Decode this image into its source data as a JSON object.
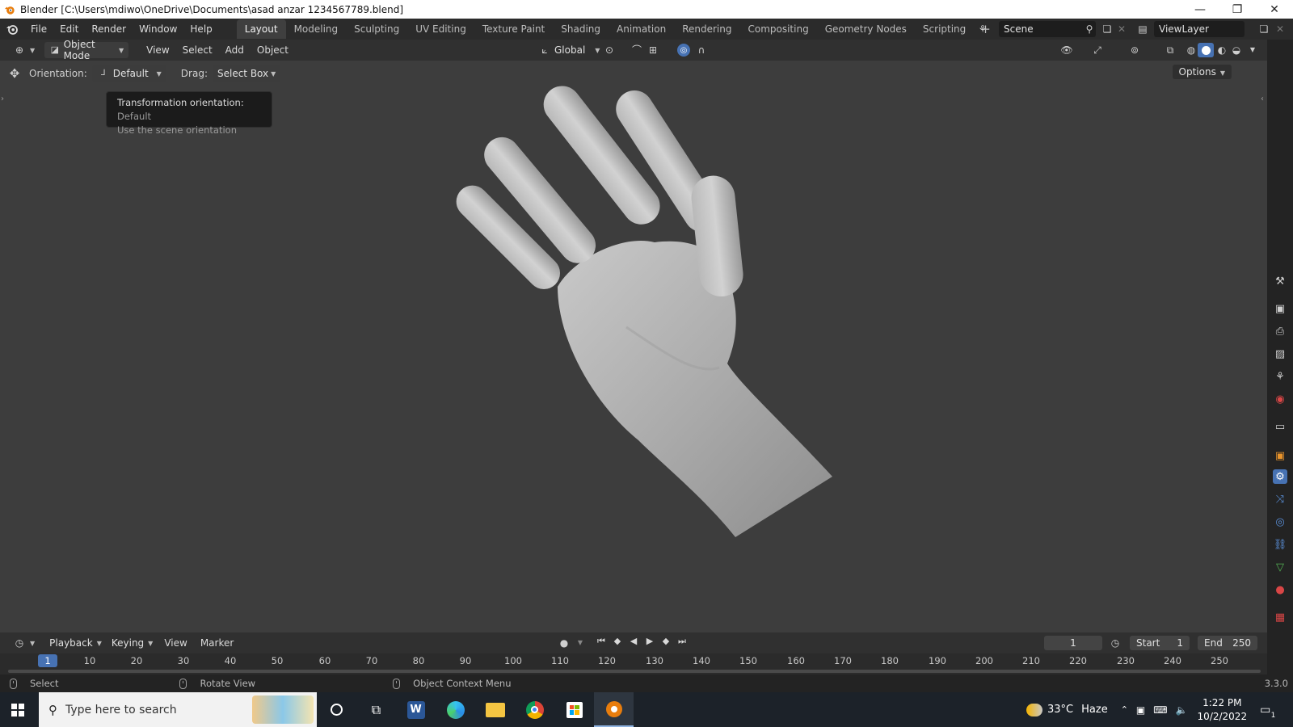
{
  "window": {
    "title": "Blender [C:\\Users\\mdiwo\\OneDrive\\Documents\\asad anzar 1234567789.blend]",
    "minimize": "—",
    "restore": "❐",
    "close": "✕"
  },
  "menus": [
    "File",
    "Edit",
    "Render",
    "Window",
    "Help"
  ],
  "workspaces": {
    "tabs": [
      "Layout",
      "Modeling",
      "Sculpting",
      "UV Editing",
      "Texture Paint",
      "Shading",
      "Animation",
      "Rendering",
      "Compositing",
      "Geometry Nodes",
      "Scripting"
    ],
    "active": "Layout",
    "add": "+"
  },
  "scene": {
    "name": "Scene",
    "view_layer": "ViewLayer"
  },
  "viewport_header": {
    "mode": "Object Mode",
    "menus": [
      "View",
      "Select",
      "Add",
      "Object"
    ],
    "transform_space": "Global"
  },
  "tool_settings": {
    "orientation_label": "Orientation:",
    "orientation_value": "Default",
    "drag_label": "Drag:",
    "drag_value": "Select Box",
    "options": "Options"
  },
  "tooltip": {
    "line1_label": "Transformation orientation:",
    "line1_value": "Default",
    "line2": "Use the scene orientation"
  },
  "timeline": {
    "menus": [
      "Playback",
      "Keying",
      "View",
      "Marker"
    ],
    "current_frame": "1",
    "start_label": "Start",
    "start_value": "1",
    "end_label": "End",
    "end_value": "250",
    "ticks": [
      "10",
      "20",
      "30",
      "40",
      "50",
      "60",
      "70",
      "80",
      "90",
      "100",
      "110",
      "120",
      "130",
      "140",
      "150",
      "160",
      "170",
      "180",
      "190",
      "200",
      "210",
      "220",
      "230",
      "240",
      "250"
    ],
    "cursor_label": "1"
  },
  "statusbar": {
    "left_action": "Select",
    "middle_action": "Rotate View",
    "right_action": "Object Context Menu",
    "version": "3.3.0"
  },
  "taskbar": {
    "search_placeholder": "Type here to search",
    "weather_temp": "33°C",
    "weather_desc": "Haze",
    "time": "1:22 PM",
    "date": "10/2/2022",
    "notification_count": "1"
  },
  "colors": {
    "accent_blue": "#4772b3",
    "viewport_bg": "#3d3d3d",
    "header_bg": "#303030",
    "active_tab_bg": "#3f3f3f",
    "blender_orange": "#e87d0d"
  },
  "icons": {
    "title": "blender-logo-icon",
    "tools": [
      "move-tool-icon",
      "viewport-shading-solid-icon",
      "properties-wrench-icon"
    ]
  }
}
